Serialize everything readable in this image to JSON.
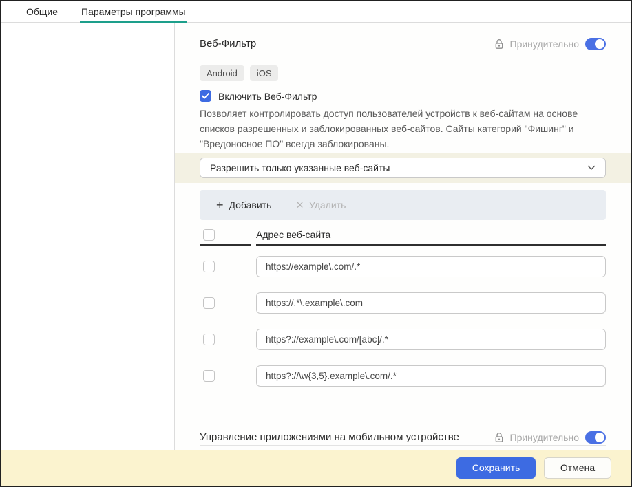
{
  "tabs": {
    "general": "Общие",
    "app_settings": "Параметры программы"
  },
  "web_filter": {
    "title": "Веб-Фильтр",
    "enforced_label": "Принудительно",
    "enforced_on": true,
    "platforms": {
      "android": "Android",
      "ios": "iOS"
    },
    "enable_label": "Включить Веб-Фильтр",
    "enable_checked": true,
    "description": "Позволяет контролировать доступ пользователей устройств к веб-сайтам на основе списков разрешенных и заблокированных веб-сайтов. Сайты категорий \"Фишинг\" и \"Вредоносное ПО\" всегда заблокированы.",
    "mode_select_value": "Разрешить только указанные веб-сайты",
    "toolbar": {
      "add_label": "Добавить",
      "add_icon": "+",
      "delete_label": "Удалить",
      "delete_icon": "×",
      "delete_enabled": false
    },
    "table": {
      "column_header": "Адрес веб-сайта",
      "rows": [
        {
          "value": "https://example\\.com/.*"
        },
        {
          "value": "https://.*\\.example\\.com"
        },
        {
          "value": "https?://example\\.com/[abc]/.*"
        },
        {
          "value": "https?://\\w{3,5}.example\\.com/.*"
        }
      ]
    }
  },
  "app_management": {
    "title": "Управление приложениями на мобильном устройстве",
    "enforced_label": "Принудительно",
    "enforced_on": true
  },
  "footer": {
    "save_label": "Сохранить",
    "cancel_label": "Отмена"
  },
  "colors": {
    "accent_teal": "#1d9f8b",
    "accent_blue": "#3d6be2",
    "highlight_strip": "#f3f1e3",
    "footer_bg": "#fbf3cf",
    "toolbar_bg": "#e9edf2"
  }
}
